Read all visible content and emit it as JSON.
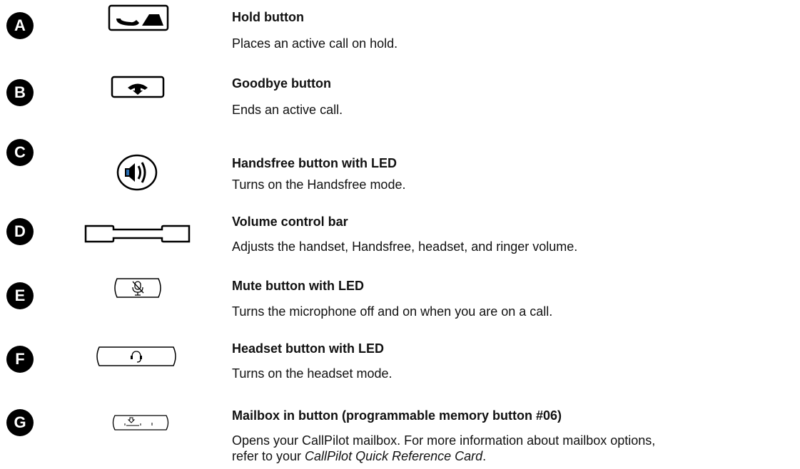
{
  "items": [
    {
      "letter": "A",
      "icon": "hold-icon",
      "title": "Hold button",
      "desc": "Places an active call on hold."
    },
    {
      "letter": "B",
      "icon": "goodbye-icon",
      "title": "Goodbye button",
      "desc": "Ends an active call."
    },
    {
      "letter": "C",
      "icon": "handsfree-icon",
      "title": "Handsfree button with LED",
      "desc": "Turns on the Handsfree mode."
    },
    {
      "letter": "D",
      "icon": "volume-bar-icon",
      "title": "Volume control bar",
      "desc": "Adjusts the handset, Handsfree, headset, and ringer volume."
    },
    {
      "letter": "E",
      "icon": "mute-icon",
      "title": "Mute button with LED",
      "desc": "Turns the microphone off and on when you are on a call."
    },
    {
      "letter": "F",
      "icon": "headset-icon",
      "title": "Headset button with LED",
      "desc": "Turns on the headset mode."
    },
    {
      "letter": "G",
      "icon": "mailbox-icon",
      "title": "Mailbox in button (programmable memory button #06)",
      "desc": "Opens your CallPilot mailbox. For more information about mailbox options,",
      "desc2_pre": "refer to your ",
      "desc2_em": "CallPilot Quick Reference Card",
      "desc2_post": "."
    }
  ]
}
